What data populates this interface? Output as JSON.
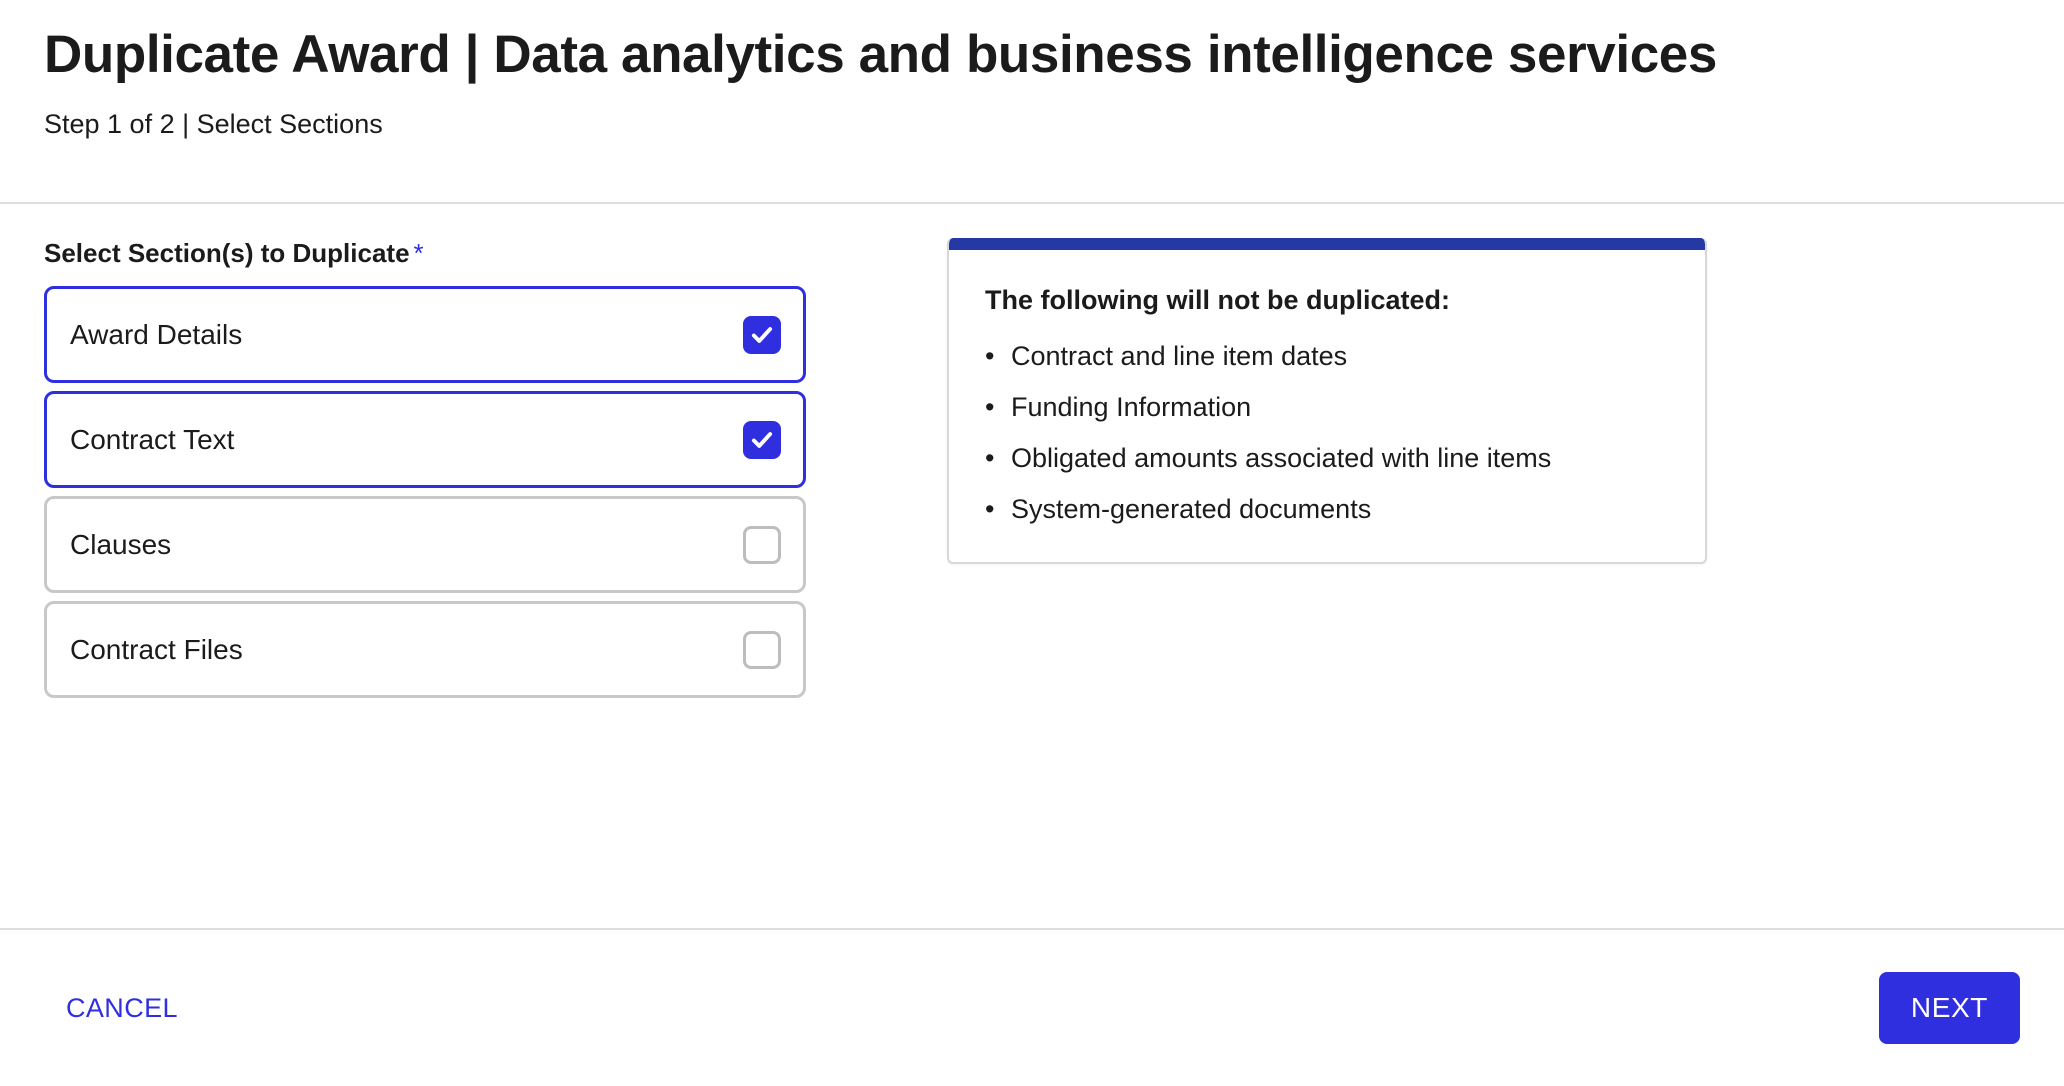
{
  "header": {
    "title": "Duplicate Award | Data analytics and business intelligence services",
    "subtitle": "Step 1 of 2 | Select Sections"
  },
  "main": {
    "section_label": "Select Section(s) to Duplicate",
    "required_marker": "*",
    "sections": [
      {
        "label": "Award Details",
        "checked": true,
        "checkbox_icon": "checkbox-checked-icon"
      },
      {
        "label": "Contract Text",
        "checked": true,
        "checkbox_icon": "checkbox-checked-icon"
      },
      {
        "label": "Clauses",
        "checked": false,
        "checkbox_icon": "checkbox-unchecked-icon"
      },
      {
        "label": "Contract Files",
        "checked": false,
        "checkbox_icon": "checkbox-unchecked-icon"
      }
    ]
  },
  "info_panel": {
    "title": "The following will not be duplicated:",
    "bullet_glyph": "•",
    "items": [
      "Contract and line item dates",
      "Funding Information",
      "Obligated amounts associated with line items",
      "System-generated documents"
    ]
  },
  "footer": {
    "cancel_label": "CANCEL",
    "next_label": "NEXT"
  },
  "colors": {
    "accent_blue": "#2F2FE0",
    "panel_bar_navy": "#2438A6",
    "text_primary": "#1B1B1B",
    "border_gray": "#C8C8C8",
    "divider_gray": "#DDDDDD"
  }
}
